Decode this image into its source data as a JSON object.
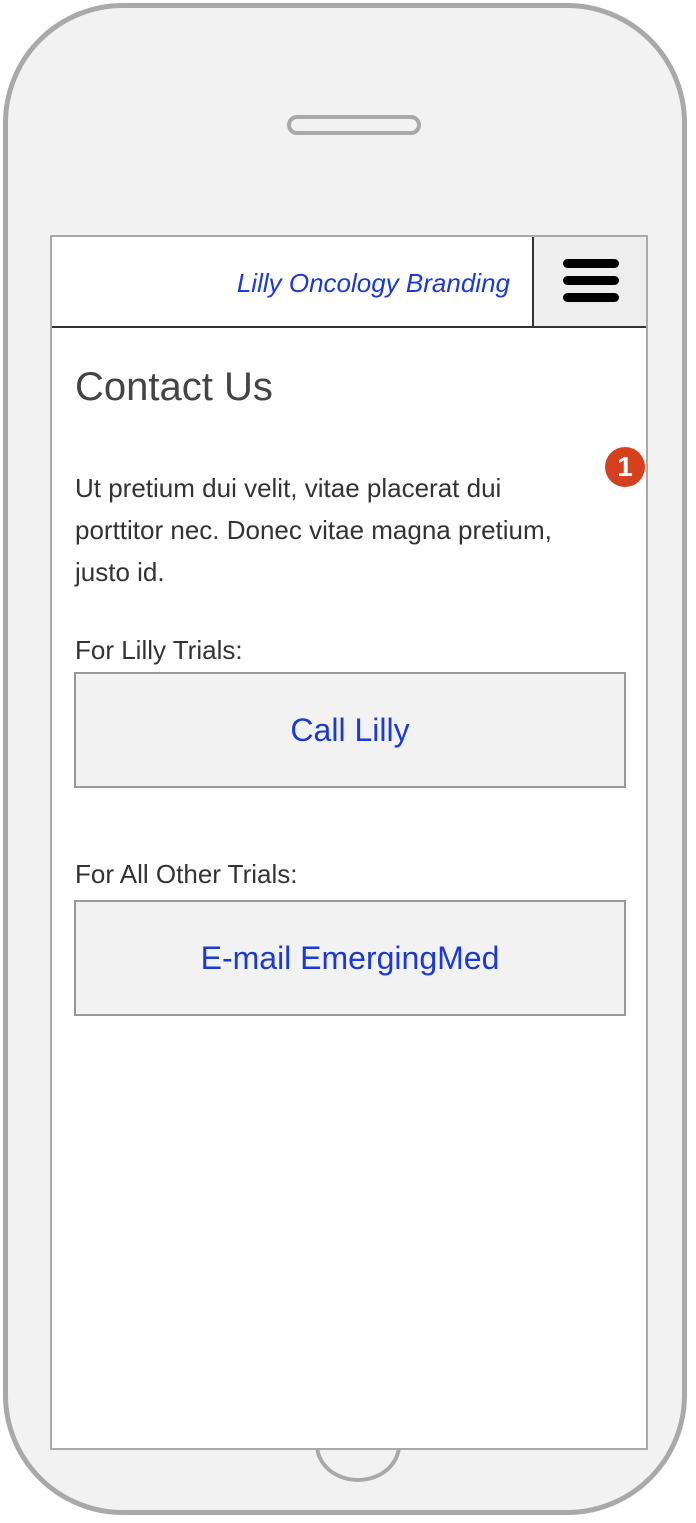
{
  "header": {
    "brand": "Lilly Oncology Branding"
  },
  "page": {
    "title": "Contact Us",
    "intro": "Ut pretium dui velit, vitae placerat dui porttitor nec. Donec vitae magna pretium, justo id.",
    "annotation_number": "1"
  },
  "contacts": [
    {
      "label": "For Lilly Trials:",
      "button_label": "Call Lilly"
    },
    {
      "label": "For All Other Trials:",
      "button_label": "E-mail EmergingMed"
    }
  ],
  "colors": {
    "link": "#1b39d8",
    "badge": "#d5401f",
    "device_frame": "#a9a9a9"
  },
  "icons": {
    "menu": "hamburger-menu-icon"
  }
}
